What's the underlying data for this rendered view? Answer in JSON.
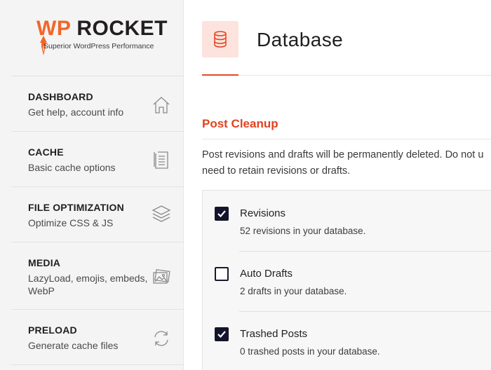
{
  "brand": {
    "wp": "WP",
    "rocket": "ROCKET",
    "tagline": "Superior WordPress Performance",
    "accent_color": "#f26629"
  },
  "sidebar": {
    "items": [
      {
        "title": "DASHBOARD",
        "desc": "Get help, account info",
        "icon": "home-icon"
      },
      {
        "title": "CACHE",
        "desc": "Basic cache options",
        "icon": "document-icon"
      },
      {
        "title": "FILE OPTIMIZATION",
        "desc": "Optimize CSS & JS",
        "icon": "layers-icon"
      },
      {
        "title": "MEDIA",
        "desc": "LazyLoad, emojis, embeds, WebP",
        "icon": "images-icon"
      },
      {
        "title": "PRELOAD",
        "desc": "Generate cache files",
        "icon": "refresh-icon"
      }
    ]
  },
  "page": {
    "icon": "database-icon",
    "title": "Database",
    "icon_bg": "#fde3dd",
    "accent_color": "#e2421f"
  },
  "post_cleanup": {
    "title": "Post Cleanup",
    "desc_line1": "Post revisions and drafts will be permanently deleted. Do not u",
    "desc_line2": "need to retain revisions or drafts.",
    "options": [
      {
        "label": "Revisions",
        "desc": "52 revisions in your database.",
        "checked": true
      },
      {
        "label": "Auto Drafts",
        "desc": "2 drafts in your database.",
        "checked": false
      },
      {
        "label": "Trashed Posts",
        "desc": "0 trashed posts in your database.",
        "checked": true
      }
    ]
  }
}
